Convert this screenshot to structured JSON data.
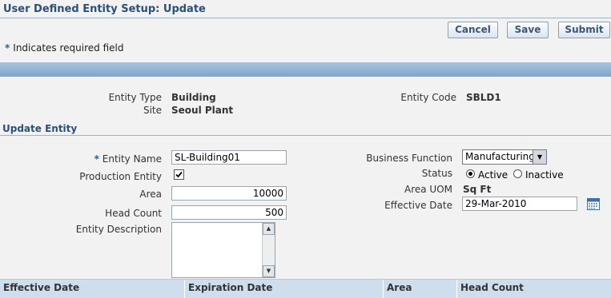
{
  "page": {
    "title": "User Defined Entity Setup: Update"
  },
  "buttons": {
    "cancel": "Cancel",
    "save": "Save",
    "submit": "Submit"
  },
  "required_note": {
    "symbol": "*",
    "text": "Indicates required field"
  },
  "header_info": {
    "entity_type": {
      "label": "Entity Type",
      "value": "Building"
    },
    "site": {
      "label": "Site",
      "value": "Seoul Plant"
    },
    "entity_code": {
      "label": "Entity Code",
      "value": "SBLD1"
    }
  },
  "section": {
    "title": "Update Entity"
  },
  "form": {
    "entity_name": {
      "label": "Entity Name",
      "required_mark": "*",
      "value": "SL-Building01"
    },
    "production_entity": {
      "label": "Production Entity",
      "checked": true
    },
    "area": {
      "label": "Area",
      "value": "10000"
    },
    "head_count": {
      "label": "Head Count",
      "value": "500"
    },
    "entity_description": {
      "label": "Entity Description",
      "value": ""
    },
    "business_function": {
      "label": "Business Function",
      "value": "Manufacturing"
    },
    "status": {
      "label": "Status",
      "options": [
        "Active",
        "Inactive"
      ],
      "selected": "Active"
    },
    "area_uom": {
      "label": "Area UOM",
      "value": "Sq Ft"
    },
    "effective_date": {
      "label": "Effective Date",
      "value": "29-Mar-2010"
    }
  },
  "table": {
    "columns": [
      "Effective Date",
      "Expiration Date",
      "Area",
      "Head Count"
    ]
  },
  "icons": {
    "calendar": "calendar-icon",
    "checkmark": "check-icon",
    "dropdown": "chevron-down-icon"
  },
  "colors": {
    "title": "#2b4e7a",
    "band": "#8fb0d2",
    "table_header": "#cfdeed"
  }
}
